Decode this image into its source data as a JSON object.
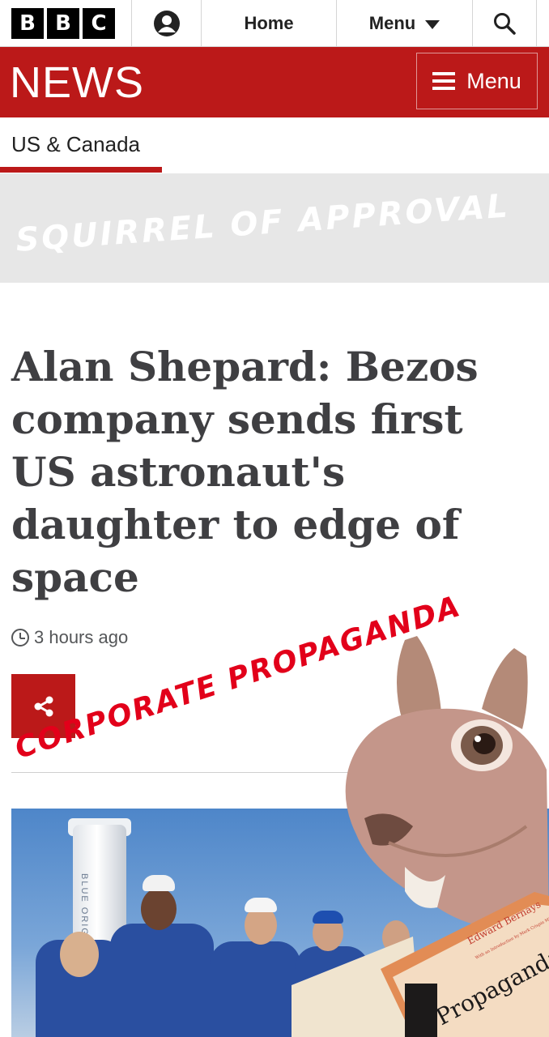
{
  "topbar": {
    "logo_letters": [
      "B",
      "B",
      "C"
    ],
    "account_icon": "user-account-icon",
    "home_label": "Home",
    "menu_label": "Menu",
    "search_icon": "search-icon"
  },
  "newsbar": {
    "logo": "NEWS",
    "menu_label": "Menu"
  },
  "section": {
    "label": "US & Canada"
  },
  "banner": {
    "text": "SQUIRREL OF APPROVAL"
  },
  "article": {
    "headline": "Alan Shepard: Bezos company sends first US astronaut's daughter to edge of space",
    "timestamp": "3 hours ago",
    "share_icon": "share-icon",
    "photo_rocket_label": "BLUE ORIGIN"
  },
  "overlays": {
    "stamp_text": "CORPORATE PROPAGANDA",
    "book_author": "Edward Bernays",
    "book_subtitle": "With an Introduction by Mark Crispin Miller",
    "book_title": "Propaganda"
  },
  "colors": {
    "bbc_red": "#bb1919",
    "stamp_red": "#e2001a",
    "headline_text": "#3f3f42"
  }
}
